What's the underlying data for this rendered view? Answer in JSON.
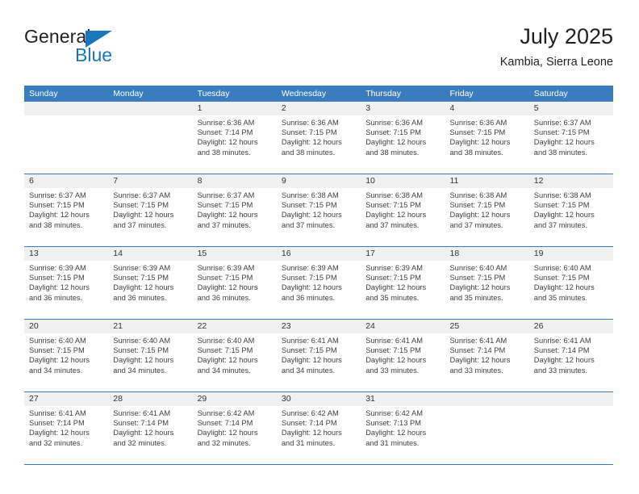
{
  "brand": {
    "name_part1": "General",
    "name_part2": "Blue",
    "logo_icon": "blue-triangle-icon"
  },
  "header": {
    "title": "July 2025",
    "subtitle": "Kambia, Sierra Leone"
  },
  "colors": {
    "header_blue": "#3b7cbe",
    "brand_blue": "#1b75bb",
    "daynum_background": "#f0f0f0",
    "text": "#404040"
  },
  "weekday_headers": [
    "Sunday",
    "Monday",
    "Tuesday",
    "Wednesday",
    "Thursday",
    "Friday",
    "Saturday"
  ],
  "weeks": [
    [
      {
        "day": "",
        "sunrise": "",
        "sunset": "",
        "daylight": "",
        "empty": true
      },
      {
        "day": "",
        "sunrise": "",
        "sunset": "",
        "daylight": "",
        "empty": true
      },
      {
        "day": "1",
        "sunrise": "Sunrise: 6:36 AM",
        "sunset": "Sunset: 7:14 PM",
        "daylight": "Daylight: 12 hours and 38 minutes."
      },
      {
        "day": "2",
        "sunrise": "Sunrise: 6:36 AM",
        "sunset": "Sunset: 7:15 PM",
        "daylight": "Daylight: 12 hours and 38 minutes."
      },
      {
        "day": "3",
        "sunrise": "Sunrise: 6:36 AM",
        "sunset": "Sunset: 7:15 PM",
        "daylight": "Daylight: 12 hours and 38 minutes."
      },
      {
        "day": "4",
        "sunrise": "Sunrise: 6:36 AM",
        "sunset": "Sunset: 7:15 PM",
        "daylight": "Daylight: 12 hours and 38 minutes."
      },
      {
        "day": "5",
        "sunrise": "Sunrise: 6:37 AM",
        "sunset": "Sunset: 7:15 PM",
        "daylight": "Daylight: 12 hours and 38 minutes."
      }
    ],
    [
      {
        "day": "6",
        "sunrise": "Sunrise: 6:37 AM",
        "sunset": "Sunset: 7:15 PM",
        "daylight": "Daylight: 12 hours and 38 minutes."
      },
      {
        "day": "7",
        "sunrise": "Sunrise: 6:37 AM",
        "sunset": "Sunset: 7:15 PM",
        "daylight": "Daylight: 12 hours and 37 minutes."
      },
      {
        "day": "8",
        "sunrise": "Sunrise: 6:37 AM",
        "sunset": "Sunset: 7:15 PM",
        "daylight": "Daylight: 12 hours and 37 minutes."
      },
      {
        "day": "9",
        "sunrise": "Sunrise: 6:38 AM",
        "sunset": "Sunset: 7:15 PM",
        "daylight": "Daylight: 12 hours and 37 minutes."
      },
      {
        "day": "10",
        "sunrise": "Sunrise: 6:38 AM",
        "sunset": "Sunset: 7:15 PM",
        "daylight": "Daylight: 12 hours and 37 minutes."
      },
      {
        "day": "11",
        "sunrise": "Sunrise: 6:38 AM",
        "sunset": "Sunset: 7:15 PM",
        "daylight": "Daylight: 12 hours and 37 minutes."
      },
      {
        "day": "12",
        "sunrise": "Sunrise: 6:38 AM",
        "sunset": "Sunset: 7:15 PM",
        "daylight": "Daylight: 12 hours and 37 minutes."
      }
    ],
    [
      {
        "day": "13",
        "sunrise": "Sunrise: 6:39 AM",
        "sunset": "Sunset: 7:15 PM",
        "daylight": "Daylight: 12 hours and 36 minutes."
      },
      {
        "day": "14",
        "sunrise": "Sunrise: 6:39 AM",
        "sunset": "Sunset: 7:15 PM",
        "daylight": "Daylight: 12 hours and 36 minutes."
      },
      {
        "day": "15",
        "sunrise": "Sunrise: 6:39 AM",
        "sunset": "Sunset: 7:15 PM",
        "daylight": "Daylight: 12 hours and 36 minutes."
      },
      {
        "day": "16",
        "sunrise": "Sunrise: 6:39 AM",
        "sunset": "Sunset: 7:15 PM",
        "daylight": "Daylight: 12 hours and 36 minutes."
      },
      {
        "day": "17",
        "sunrise": "Sunrise: 6:39 AM",
        "sunset": "Sunset: 7:15 PM",
        "daylight": "Daylight: 12 hours and 35 minutes."
      },
      {
        "day": "18",
        "sunrise": "Sunrise: 6:40 AM",
        "sunset": "Sunset: 7:15 PM",
        "daylight": "Daylight: 12 hours and 35 minutes."
      },
      {
        "day": "19",
        "sunrise": "Sunrise: 6:40 AM",
        "sunset": "Sunset: 7:15 PM",
        "daylight": "Daylight: 12 hours and 35 minutes."
      }
    ],
    [
      {
        "day": "20",
        "sunrise": "Sunrise: 6:40 AM",
        "sunset": "Sunset: 7:15 PM",
        "daylight": "Daylight: 12 hours and 34 minutes."
      },
      {
        "day": "21",
        "sunrise": "Sunrise: 6:40 AM",
        "sunset": "Sunset: 7:15 PM",
        "daylight": "Daylight: 12 hours and 34 minutes."
      },
      {
        "day": "22",
        "sunrise": "Sunrise: 6:40 AM",
        "sunset": "Sunset: 7:15 PM",
        "daylight": "Daylight: 12 hours and 34 minutes."
      },
      {
        "day": "23",
        "sunrise": "Sunrise: 6:41 AM",
        "sunset": "Sunset: 7:15 PM",
        "daylight": "Daylight: 12 hours and 34 minutes."
      },
      {
        "day": "24",
        "sunrise": "Sunrise: 6:41 AM",
        "sunset": "Sunset: 7:15 PM",
        "daylight": "Daylight: 12 hours and 33 minutes."
      },
      {
        "day": "25",
        "sunrise": "Sunrise: 6:41 AM",
        "sunset": "Sunset: 7:14 PM",
        "daylight": "Daylight: 12 hours and 33 minutes."
      },
      {
        "day": "26",
        "sunrise": "Sunrise: 6:41 AM",
        "sunset": "Sunset: 7:14 PM",
        "daylight": "Daylight: 12 hours and 33 minutes."
      }
    ],
    [
      {
        "day": "27",
        "sunrise": "Sunrise: 6:41 AM",
        "sunset": "Sunset: 7:14 PM",
        "daylight": "Daylight: 12 hours and 32 minutes."
      },
      {
        "day": "28",
        "sunrise": "Sunrise: 6:41 AM",
        "sunset": "Sunset: 7:14 PM",
        "daylight": "Daylight: 12 hours and 32 minutes."
      },
      {
        "day": "29",
        "sunrise": "Sunrise: 6:42 AM",
        "sunset": "Sunset: 7:14 PM",
        "daylight": "Daylight: 12 hours and 32 minutes."
      },
      {
        "day": "30",
        "sunrise": "Sunrise: 6:42 AM",
        "sunset": "Sunset: 7:14 PM",
        "daylight": "Daylight: 12 hours and 31 minutes."
      },
      {
        "day": "31",
        "sunrise": "Sunrise: 6:42 AM",
        "sunset": "Sunset: 7:13 PM",
        "daylight": "Daylight: 12 hours and 31 minutes."
      },
      {
        "day": "",
        "sunrise": "",
        "sunset": "",
        "daylight": "",
        "empty": true
      },
      {
        "day": "",
        "sunrise": "",
        "sunset": "",
        "daylight": "",
        "empty": true
      }
    ]
  ]
}
